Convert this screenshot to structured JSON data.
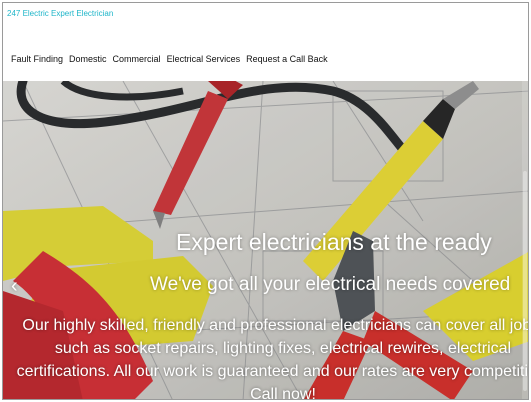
{
  "header": {
    "brand": "247 Electric Expert Electrician"
  },
  "nav": {
    "items": [
      "Fault Finding",
      "Domestic",
      "Commercial",
      "Electrical Services",
      "Request a Call Back"
    ]
  },
  "hero": {
    "title": "Expert electricians at the ready",
    "subtitle": "We've got all your electrical needs covered",
    "body": "Our highly skilled, friendly and professional electricians can cover all jobs, such as socket repairs, lighting fixes, electrical rewires, electrical certifications. All our work is guaranteed and our rates are very competitive. Call now!",
    "prev_arrow": "‹"
  },
  "colors": {
    "brand": "#1fb6c9",
    "nav_text": "#111111",
    "hero_text": "#ffffff"
  }
}
